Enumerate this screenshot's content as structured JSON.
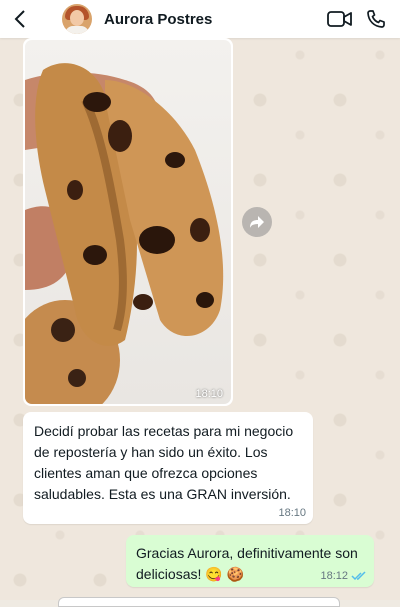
{
  "header": {
    "back_icon": "chevron-left-icon",
    "contact_name": "Aurora Postres",
    "video_icon": "video-camera-icon",
    "call_icon": "phone-icon"
  },
  "messages": [
    {
      "type": "image",
      "direction": "incoming",
      "image_subject": "chocolate chip cookie broken in half",
      "time": "18:10"
    },
    {
      "type": "text",
      "direction": "incoming",
      "text": "Decidí probar las recetas para mi negocio de repostería y han sido un éxito. Los clientes aman que ofrezca opciones saludables. Esta es una GRAN inversión.",
      "time": "18:10"
    },
    {
      "type": "text",
      "direction": "outgoing",
      "text": "Gracias Aurora, definitivamente son deliciosas! 😋 🍪",
      "time": "18:12",
      "status_icon": "double-check-read-icon"
    }
  ],
  "forward_icon": "forward-arrow-icon",
  "colors": {
    "outgoing_bubble": "#d9fdd3",
    "incoming_bubble": "#ffffff",
    "read_ticks": "#53bdeb",
    "chat_wallpaper": "#efe7dd"
  }
}
